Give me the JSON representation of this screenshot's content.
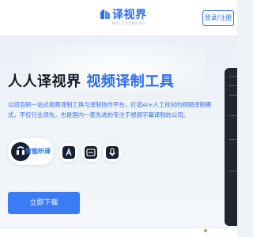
{
  "header": {
    "logo_text": "译视界",
    "logo_subtext": "MULTIDUBBING",
    "login_label": "登录/注册"
  },
  "hero": {
    "title_part1": "人人译视界",
    "title_part2": "视频译制工具",
    "description": "公司自研一站式视频译制工具与译制协作平台，打造AI+人工校对的视频译制模式，不仅行业领先，也是国内一家先进的专注于视频字幕译制的公司。",
    "featured_tool_label": "智能听译",
    "download_label": "立即下载"
  },
  "colors": {
    "brand_blue": "#2d6cf0",
    "button_blue": "#3a7cf5",
    "dark_icon": "#162033"
  }
}
